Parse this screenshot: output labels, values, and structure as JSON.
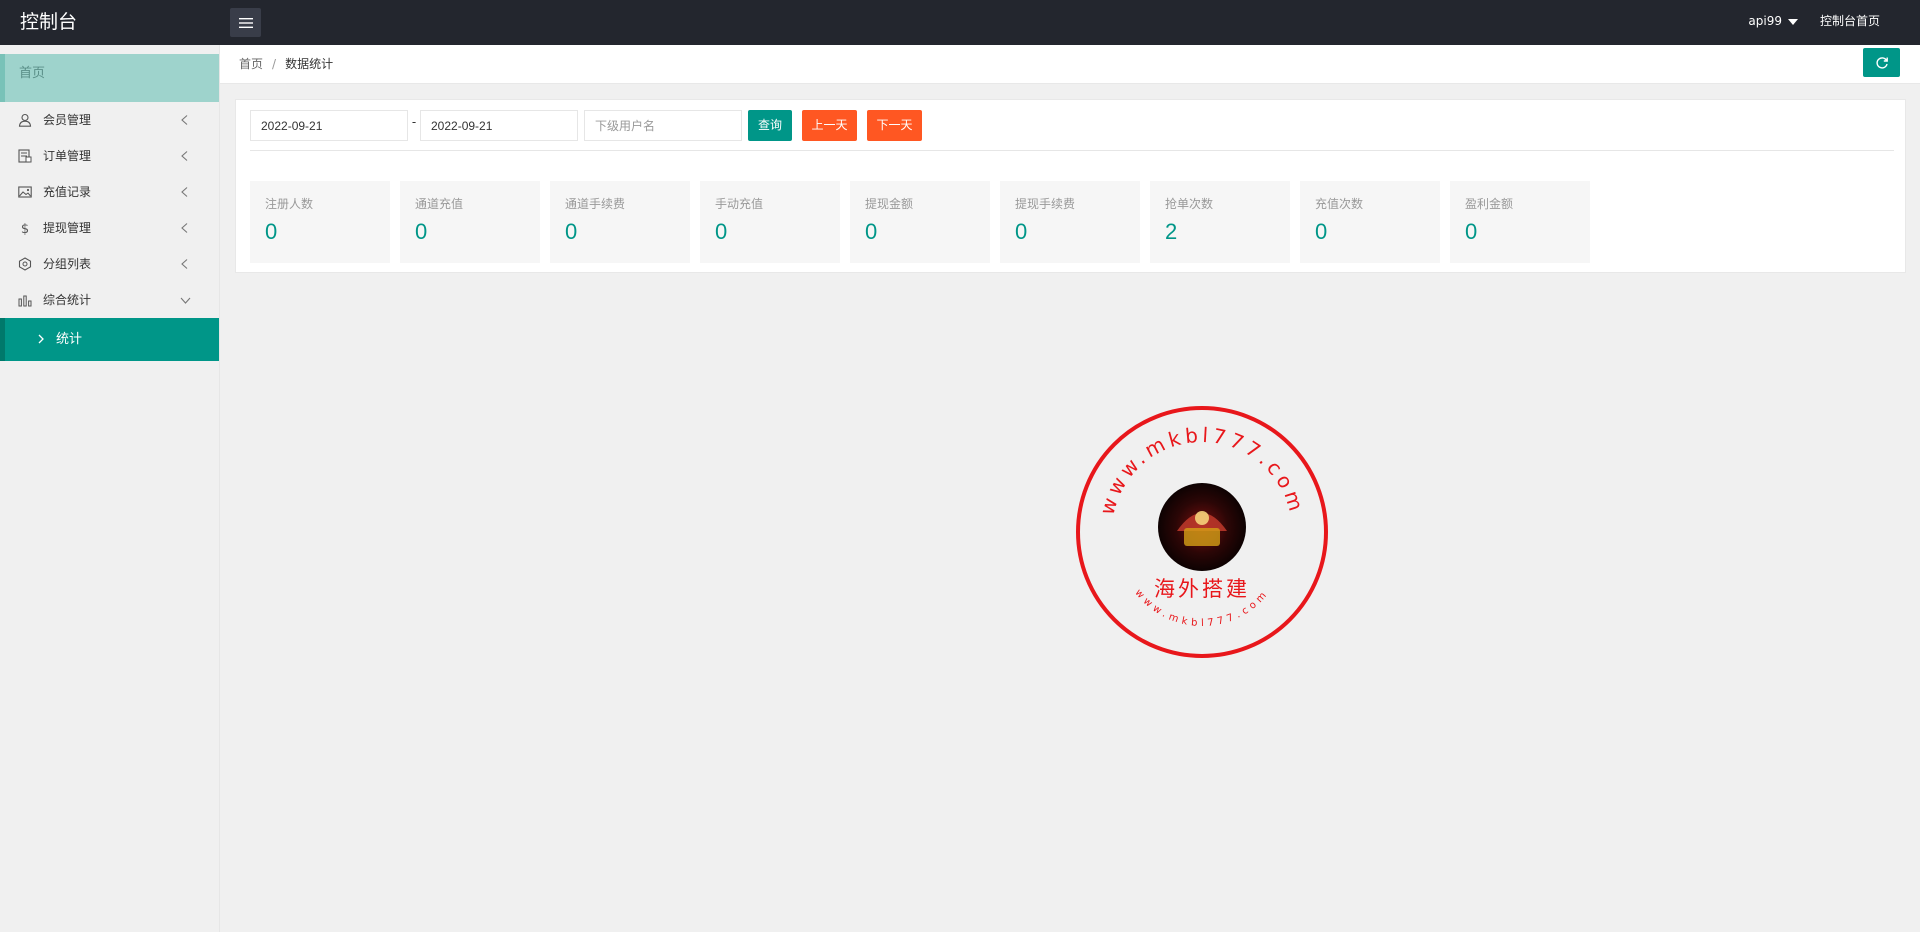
{
  "app": {
    "title": "控制台"
  },
  "topbar": {
    "user_name": "api99",
    "home_link": "控制台首页"
  },
  "sidebar": {
    "home": "首页",
    "items": [
      {
        "label": "会员管理",
        "icon": "user-icon"
      },
      {
        "label": "订单管理",
        "icon": "order-icon"
      },
      {
        "label": "充值记录",
        "icon": "image-icon"
      },
      {
        "label": "提现管理",
        "icon": "dollar-icon"
      },
      {
        "label": "分组列表",
        "icon": "group-icon"
      },
      {
        "label": "综合统计",
        "icon": "chart-icon"
      }
    ],
    "sub_active": "统计"
  },
  "breadcrumb": {
    "home": "首页",
    "separator": "/",
    "current": "数据统计"
  },
  "filter": {
    "date_start": "2022-09-21",
    "date_end": "2022-09-21",
    "date_separator": "-",
    "user_placeholder": "下级用户名",
    "query_label": "查询",
    "prev_day_label": "上一天",
    "next_day_label": "下一天"
  },
  "stats": [
    {
      "label": "注册人数",
      "value": "0"
    },
    {
      "label": "通道充值",
      "value": "0"
    },
    {
      "label": "通道手续费",
      "value": "0"
    },
    {
      "label": "手动充值",
      "value": "0"
    },
    {
      "label": "提现金额",
      "value": "0"
    },
    {
      "label": "提现手续费",
      "value": "0"
    },
    {
      "label": "抢单次数",
      "value": "2"
    },
    {
      "label": "充值次数",
      "value": "0"
    },
    {
      "label": "盈利金额",
      "value": "0"
    }
  ],
  "watermark": {
    "outer_text": "www.mkbl777.com",
    "center_text": "海外搭建",
    "inner_text": "www.mkbl777.com"
  },
  "colors": {
    "topbar": "#23262e",
    "accent": "#009688",
    "orange": "#ff5722",
    "stamp_red": "#e8171b"
  }
}
